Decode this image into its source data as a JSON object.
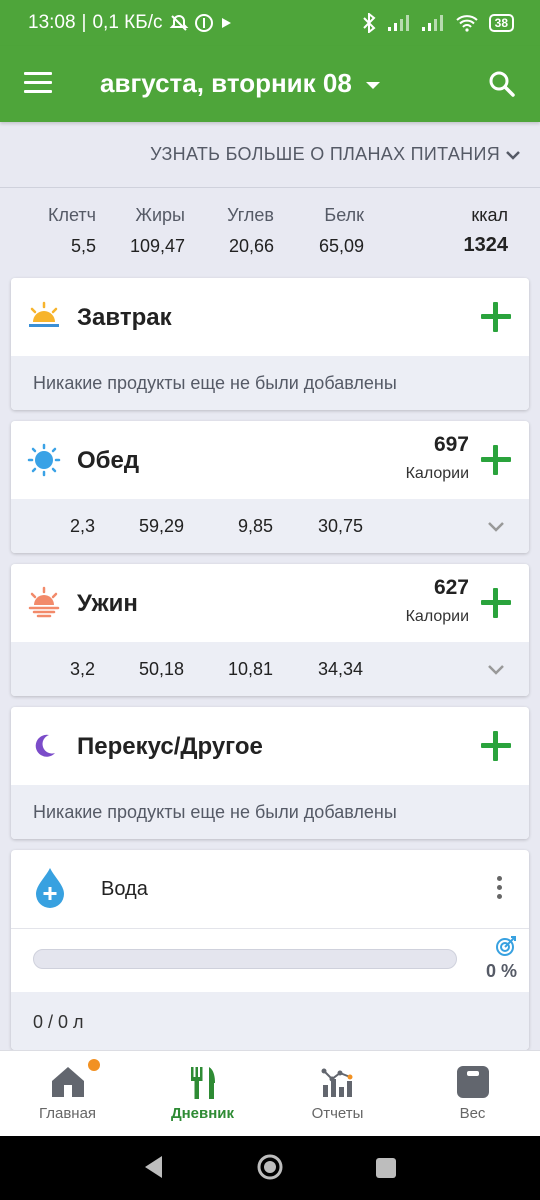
{
  "status_bar": {
    "time": "13:08",
    "speed": "0,1 КБ/с",
    "battery": "38"
  },
  "app_bar": {
    "title": "августа, вторник 08"
  },
  "plans_link": "УЗНАТЬ БОЛЬШЕ О ПЛАНАХ ПИТАНИЯ",
  "totals": {
    "fiber": {
      "label": "Клетч",
      "value": "5,5"
    },
    "fat": {
      "label": "Жиры",
      "value": "109,47"
    },
    "carbs": {
      "label": "Углев",
      "value": "20,66"
    },
    "protein": {
      "label": "Белк",
      "value": "65,09"
    },
    "kcal": {
      "label": "ккал",
      "value": "1324"
    }
  },
  "meals": [
    {
      "name": "Завтрак",
      "empty_text": "Никакие продукты еще не были добавлены"
    },
    {
      "name": "Обед",
      "kcal": "697",
      "kcal_unit": "Калории",
      "macros": [
        "2,3",
        "59,29",
        "9,85",
        "30,75"
      ]
    },
    {
      "name": "Ужин",
      "kcal": "627",
      "kcal_unit": "Калории",
      "macros": [
        "3,2",
        "50,18",
        "10,81",
        "34,34"
      ]
    },
    {
      "name": "Перекус/Другое",
      "empty_text": "Никакие продукты еще не были добавлены"
    }
  ],
  "water": {
    "title": "Вода",
    "progress_percent": 0,
    "percent_label": "0 %",
    "amount": "0 / 0 л"
  },
  "bottom_nav": [
    {
      "label": "Главная",
      "icon": "home-icon",
      "active": false
    },
    {
      "label": "Дневник",
      "icon": "fork-knife-icon",
      "active": true
    },
    {
      "label": "Отчеты",
      "icon": "chart-icon",
      "active": false
    },
    {
      "label": "Вес",
      "icon": "scale-icon",
      "active": false
    }
  ],
  "colors": {
    "primary": "#4ea53a",
    "add": "#2aa33c",
    "water": "#38a1e0",
    "badge": "#f29122"
  }
}
